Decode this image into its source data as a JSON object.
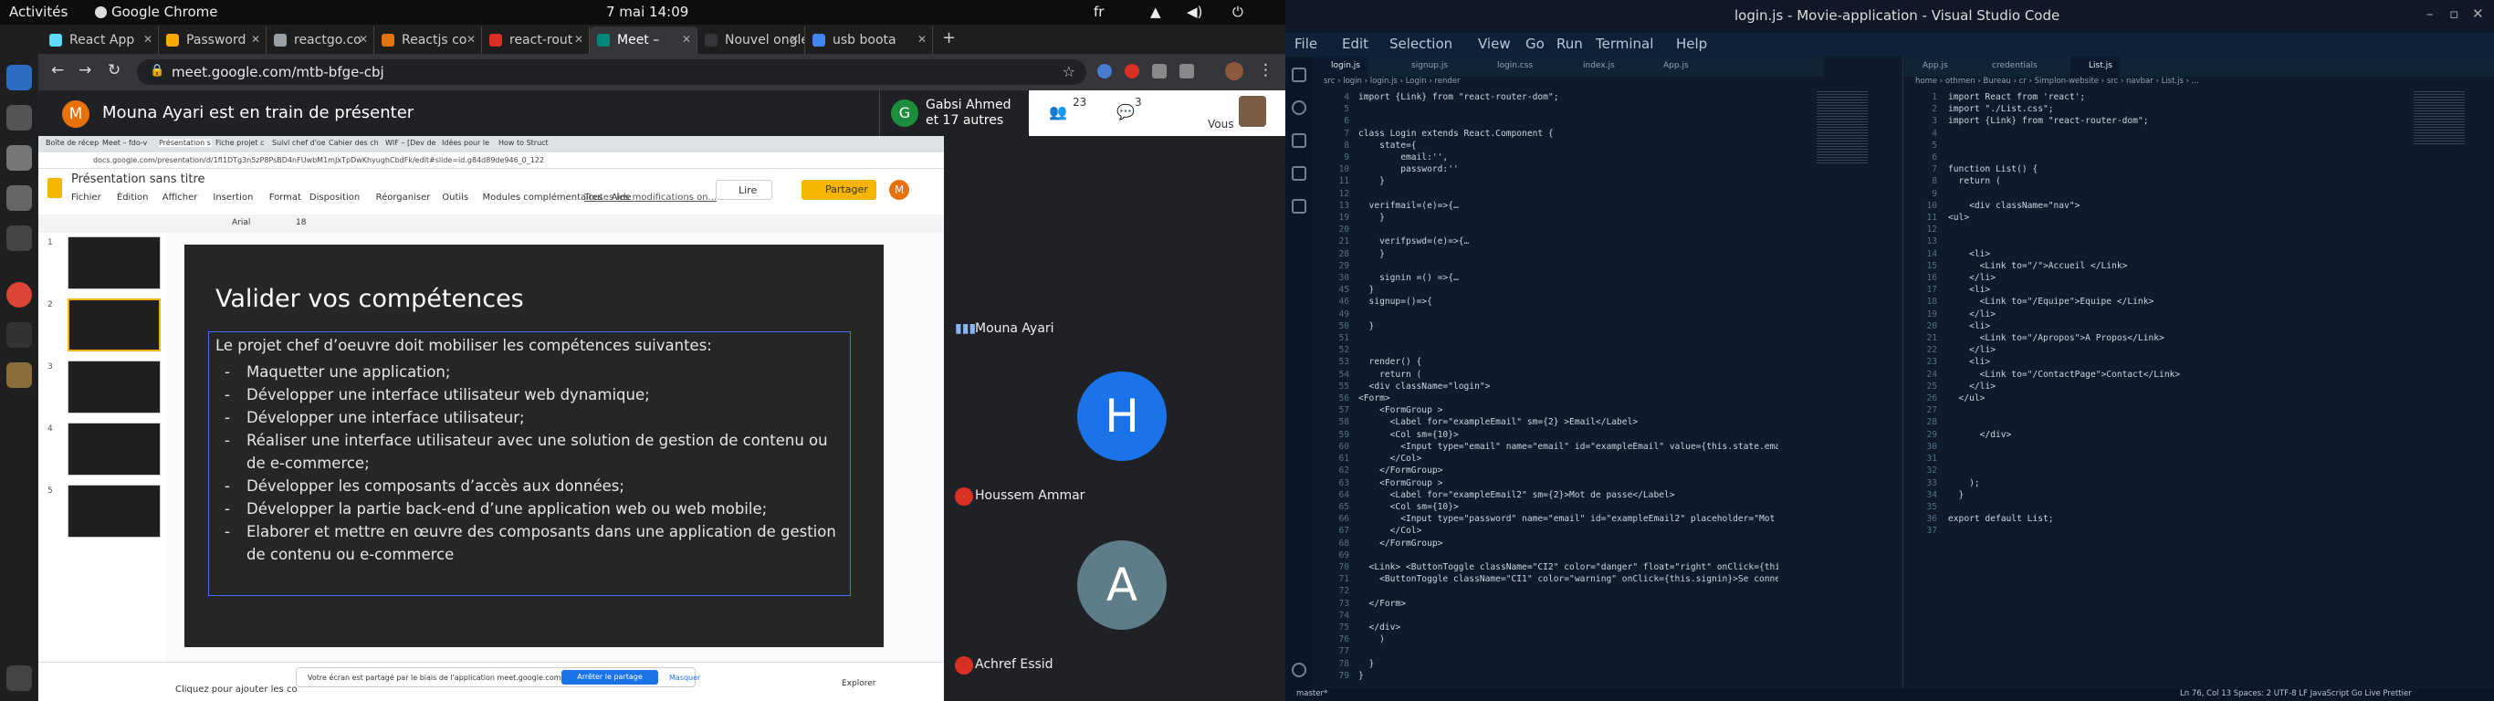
{
  "os_topbar": {
    "activities": "Activités",
    "app": "Google Chrome",
    "datetime": "7 mai  14:09",
    "lang": "fr"
  },
  "chrome": {
    "tabs": [
      {
        "label": "React App",
        "color": "#61dafb"
      },
      {
        "label": "Password",
        "color": "#f9ab00"
      },
      {
        "label": "reactgo.co",
        "color": "#9aa0a6"
      },
      {
        "label": "Reactjs co",
        "color": "#e8710a"
      },
      {
        "label": "react-rout",
        "color": "#d93025"
      },
      {
        "label": "Meet –",
        "color": "#00897b"
      },
      {
        "label": "Nouvel onglet",
        "color": "#35363a"
      },
      {
        "label": "usb boota",
        "color": "#4285f4"
      }
    ],
    "url": "meet.google.com/mtb-bfge-cbj"
  },
  "meet": {
    "presenter_initial": "M",
    "presenting_text": "Mouna Ayari est en train de présenter",
    "participants_count": "23",
    "chat_count": "3",
    "you_label": "Vous",
    "host_initial": "G",
    "host_name": "Gabsi Ahmed",
    "host_others": "et 17 autres",
    "people": [
      {
        "name": "Mouna Ayari"
      },
      {
        "name": "Houssem Ammar",
        "initial": "H",
        "color": "#1a73e8"
      },
      {
        "name": "Achref Essid",
        "initial": "A",
        "color": "#5f7d89"
      }
    ]
  },
  "slides": {
    "inner_tabs": [
      "Boîte de récep",
      "Meet – fdo-v",
      "Présentation s",
      "Fiche projet c",
      "Suivi chef d'oe",
      "Cahier des ch",
      "WIF – [Dev de",
      "Idées pour le",
      "How to Struct"
    ],
    "inner_url": "docs.google.com/presentation/d/1fI1DTg3n5zP8PsBD4nFUwbM1mJxTpDwKhyughCbdFk/edit#slide=id.g84d89de946_0_122",
    "doc_title": "Présentation sans titre",
    "menu": [
      "Fichier",
      "Édition",
      "Afficher",
      "Insertion",
      "Format",
      "Disposition",
      "Réorganiser",
      "Outils",
      "Modules complémentaires",
      "Aide"
    ],
    "last_edit": "Toutes les modifications on...",
    "present_label": "Lire",
    "share_label": "Partager",
    "user_initial": "M",
    "font": "Arial",
    "font_size": "18",
    "slide": {
      "title": "Valider vos compétences",
      "intro": "Le projet chef d’oeuvre doit mobiliser les compétences suivantes:",
      "bullets": [
        "Maquetter une application;",
        "Développer une interface utilisateur web dynamique;",
        "Développer une interface utilisateur;",
        "Réaliser une interface utilisateur avec une solution de gestion de contenu ou de e-commerce;",
        "Développer les composants d’accès aux données;",
        "Développer la partie back-end d’une application web ou web mobile;",
        "Elaborer et mettre en œuvre des composants dans une application de gestion de contenu ou e-commerce"
      ]
    },
    "notes_placeholder": "Cliquez pour ajouter les co",
    "share_msg": "Votre écran est partagé par le biais de l'application meet.google.com.",
    "stop_share": "Arrêter le partage",
    "hide": "Masquer",
    "explore": "Explorer"
  },
  "vscode": {
    "title": "login.js - Movie-application - Visual Studio Code",
    "menu": [
      "File",
      "Edit",
      "Selection",
      "View",
      "Go",
      "Run",
      "Terminal",
      "Help"
    ],
    "left_tabs": [
      "login.js",
      "signup.js",
      "login.css",
      "index.js",
      "App.js"
    ],
    "left_crumbs": "src › login › login.js › Login › render",
    "right_tabs": [
      "App.js",
      "credentials",
      "List.js"
    ],
    "right_crumbs": "home › othmen › Bureau › cr › Simplon-website › src › navbar › List.js › ...",
    "left_start_line": 4,
    "left_lines": [
      "import {Link} from \"react-router-dom\";",
      "",
      "",
      "class Login extends React.Component {",
      "    state={",
      "        email:'',",
      "        password:''",
      "    }",
      "",
      "  verifmail=(e)=>{…",
      "    }",
      "",
      "    verifpswd=(e)=>{…",
      "    }",
      "",
      "    signin =() =>{…",
      "  }",
      "  signup=()=>{",
      "",
      "  }",
      "",
      "",
      "  render() {",
      "    return (",
      "  <div className=\"login\">",
      "<Form>",
      "    <FormGroup >",
      "      <Label for=\"exampleEmail\" sm={2} >Email</Label>",
      "      <Col sm={10}>",
      "        <Input type=\"email\" name=\"email\" id=\"exampleEmail\" value={this.state.email",
      "      </Col>",
      "    </FormGroup>",
      "    <FormGroup >",
      "      <Label for=\"exampleEmail2\" sm={2}>Mot de passe</Label>",
      "      <Col sm={10}>",
      "        <Input type=\"password\" name=\"email\" id=\"exampleEmail2\" placeholder=\"Mot de",
      "      </Col>",
      "    </FormGroup>",
      "",
      "  <Link> <ButtonToggle className=\"CI2\" color=\"danger\" float=\"right\" onClick={this",
      "    <ButtonToggle className=\"CI1\" color=\"warning\" onClick={this.signin}>Se connect",
      "",
      "  </Form>",
      "",
      "  </div>",
      "    )",
      "",
      "  }",
      "}"
    ],
    "left_line_numbers": "4\n5\n6\n7\n8\n9\n10\n11\n12\n13\n19\n20\n21\n28\n29\n30\n45\n46\n49\n50\n51\n52\n53\n54\n55\n56\n57\n58\n59\n60\n61\n62\n63\n64\n65\n66\n67\n68\n69\n70\n71\n72\n73\n74\n75\n76\n77\n78\n79",
    "right_lines": [
      "import React from 'react';",
      "import \"./List.css\";",
      "import {Link} from \"react-router-dom\";",
      "",
      "",
      "",
      "function List() {",
      "  return (",
      "",
      "    <div className=\"nav\">",
      "<ul>",
      "",
      "",
      "    <li>",
      "      <Link to=\"/\">Accueil </Link>",
      "    </li>",
      "    <li>",
      "      <Link to=\"/Equipe\">Equipe </Link>",
      "    </li>",
      "    <li>",
      "      <Link to=\"/Apropos\">A Propos</Link>",
      "    </li>",
      "    <li>",
      "      <Link to=\"/ContactPage\">Contact</Link>",
      "    </li>",
      "  </ul>",
      "",
      "",
      "      </div>",
      "",
      "",
      "",
      "    );",
      "  }",
      "",
      "export default List;"
    ],
    "right_line_numbers": "1\n2\n3\n4\n5\n6\n7\n8\n9\n10\n11\n12\n13\n14\n15\n16\n17\n18\n19\n20\n21\n22\n23\n24\n25\n26\n27\n28\n29\n30\n31\n32\n33\n34\n35\n36\n37",
    "status_left": "master*",
    "status_right": "Ln 76, Col 13   Spaces: 2   UTF-8   LF   JavaScript   Go Live   Prettier"
  }
}
